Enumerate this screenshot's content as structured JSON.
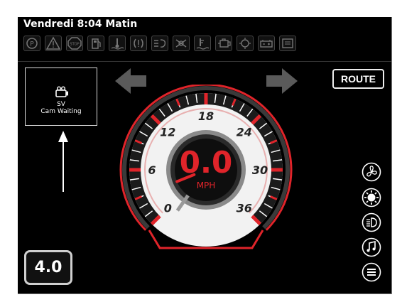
{
  "status_bar": {
    "clock": "Vendredi 8:04 Matin"
  },
  "telltales": [
    {
      "icon": "parking-brake-icon"
    },
    {
      "icon": "warning-triangle-icon"
    },
    {
      "icon": "stop-icon"
    },
    {
      "icon": "fuel-pump-icon"
    },
    {
      "icon": "coolant-temperature-icon"
    },
    {
      "icon": "transmission-warning-icon"
    },
    {
      "icon": "oil-level-icon"
    },
    {
      "icon": "abs-warning-icon"
    },
    {
      "icon": "water-in-fuel-icon"
    },
    {
      "icon": "engine-check-icon"
    },
    {
      "icon": "lamp-warning-icon"
    },
    {
      "icon": "battery-icon"
    },
    {
      "icon": "air-filter-icon"
    }
  ],
  "camera": {
    "line1": "SV",
    "line2": "Cam Waiting"
  },
  "route_button": {
    "label": "ROUTE"
  },
  "speedometer": {
    "value": "0.0",
    "unit": "MPH",
    "tick_labels": [
      "0",
      "6",
      "12",
      "18",
      "24",
      "30",
      "36"
    ]
  },
  "gear": {
    "value": "4.0"
  },
  "side_controls": [
    {
      "icon": "fan-icon"
    },
    {
      "icon": "brightness-icon"
    },
    {
      "icon": "headlight-icon"
    },
    {
      "icon": "music-icon"
    },
    {
      "icon": "menu-icon"
    }
  ],
  "colors": {
    "accent": "#e0242a",
    "background": "#000000",
    "gauge_face": "#f2f2f2"
  }
}
